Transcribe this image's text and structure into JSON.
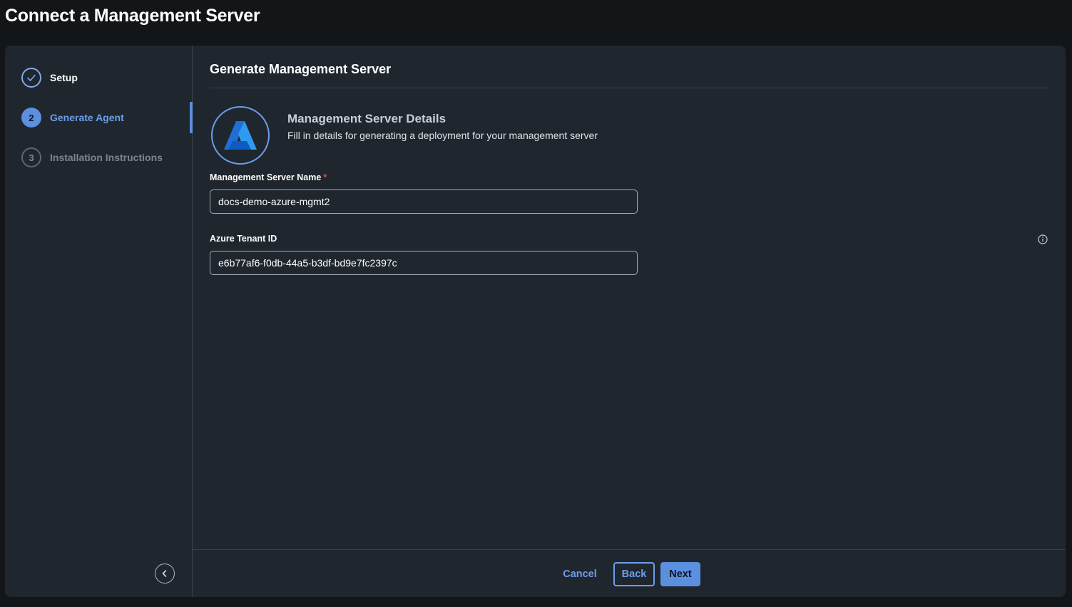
{
  "page": {
    "title": "Connect a Management Server"
  },
  "steps": [
    {
      "number": "1",
      "label": "Setup",
      "state": "done"
    },
    {
      "number": "2",
      "label": "Generate Agent",
      "state": "active"
    },
    {
      "number": "3",
      "label": "Installation Instructions",
      "state": "pending"
    }
  ],
  "main": {
    "section_title": "Generate Management Server",
    "details_title": "Management Server Details",
    "details_subtitle": "Fill in details for generating a deployment for your management server",
    "logo_icon": "azure-logo-icon"
  },
  "form": {
    "server_name": {
      "label": "Management Server Name",
      "required_mark": "*",
      "value": "docs-demo-azure-mgmt2"
    },
    "tenant_id": {
      "label": "Azure Tenant ID",
      "value": "e6b77af6-f0db-44a5-b3df-bd9e7fc2397c"
    }
  },
  "footer": {
    "cancel_label": "Cancel",
    "back_label": "Back",
    "next_label": "Next"
  },
  "colors": {
    "accent": "#5b8fe0",
    "panel_bg": "#20262e",
    "page_bg": "#131619",
    "required": "#e5484d"
  }
}
